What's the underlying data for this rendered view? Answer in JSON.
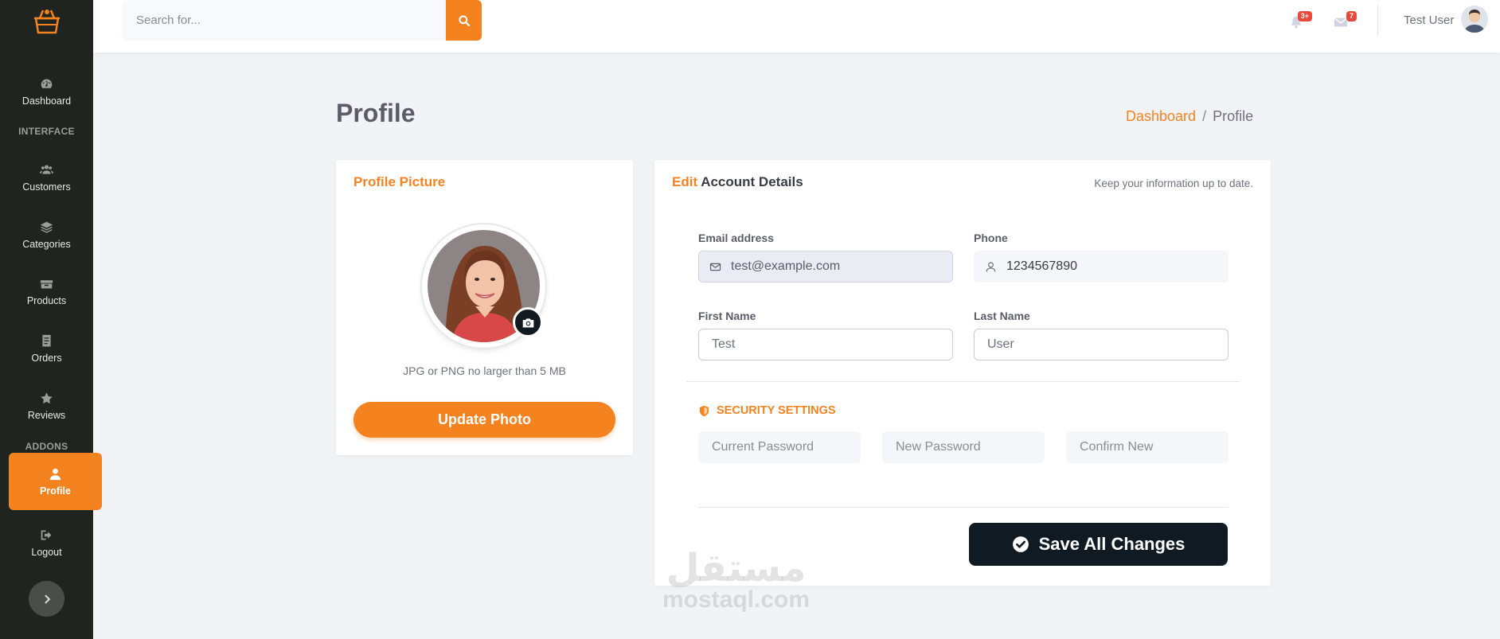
{
  "sidebar": {
    "heading_interface": "INTERFACE",
    "heading_addons": "ADDONS",
    "items": [
      {
        "label": "Dashboard"
      },
      {
        "label": "Customers"
      },
      {
        "label": "Categories"
      },
      {
        "label": "Products"
      },
      {
        "label": "Orders"
      },
      {
        "label": "Reviews"
      },
      {
        "label": "Profile"
      },
      {
        "label": "Logout"
      }
    ],
    "active_item": "Profile"
  },
  "topbar": {
    "search_placeholder": "Search for...",
    "notifications_badge": "3+",
    "messages_badge": "7",
    "user_name": "Test User"
  },
  "page": {
    "title": "Profile",
    "breadcrumb": {
      "link": "Dashboard",
      "separator": "/",
      "current": "Profile"
    }
  },
  "profile_picture": {
    "title": "Profile Picture",
    "hint": "JPG or PNG no larger than 5 MB",
    "button": "Update Photo"
  },
  "account": {
    "title_accent": "Edit",
    "title_rest": "Account Details",
    "subtitle": "Keep your information up to date.",
    "email_label": "Email address",
    "email_value": "test@example.com",
    "phone_label": "Phone",
    "phone_value": "1234567890",
    "first_name_label": "First Name",
    "first_name_value": "Test",
    "last_name_label": "Last Name",
    "last_name_value": "User"
  },
  "security": {
    "title": "SECURITY SETTINGS",
    "current_password_placeholder": "Current Password",
    "new_password_placeholder": "New Password",
    "confirm_password_placeholder": "Confirm New"
  },
  "save_button": "Save All Changes",
  "watermark": {
    "arabic": "مستقل",
    "latin": "mostaql.com"
  },
  "colors": {
    "accent": "#f4821f",
    "sidebar_bg": "#1f2420",
    "page_bg": "#f2f3f7",
    "save_button_bg": "#0f1a22",
    "badge": "#e74a3b"
  }
}
